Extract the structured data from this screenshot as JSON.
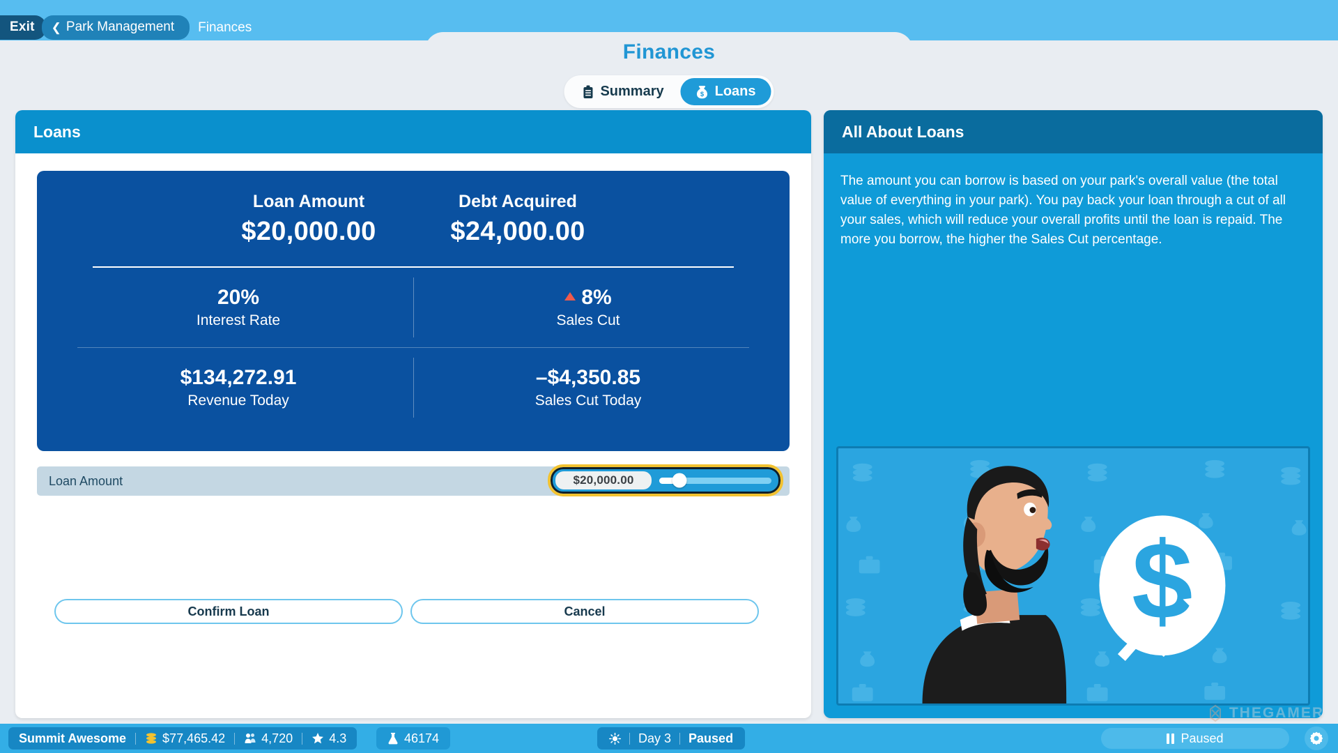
{
  "topbar": {
    "exit_label": "Exit",
    "back_chevron": "chevron-left-icon",
    "parent_label": "Park Management",
    "current_label": "Finances"
  },
  "header": {
    "title": "Finances"
  },
  "tabs": [
    {
      "label": "Summary",
      "icon": "clipboard-icon",
      "active": false
    },
    {
      "label": "Loans",
      "icon": "money-bag-icon",
      "active": true
    }
  ],
  "loans_panel": {
    "title": "Loans",
    "summary": {
      "loan_amount_label": "Loan Amount",
      "loan_amount_value": "$20,000.00",
      "debt_acquired_label": "Debt Acquired",
      "debt_acquired_value": "$24,000.00",
      "interest_rate_value": "20%",
      "interest_rate_label": "Interest Rate",
      "sales_cut_value": "8%",
      "sales_cut_label": "Sales Cut",
      "sales_cut_trend_icon": "triangle-up-icon",
      "sales_cut_trend_color": "#ef5a4c",
      "revenue_today_value": "$134,272.91",
      "revenue_today_label": "Revenue Today",
      "sales_cut_today_value": "–$4,350.85",
      "sales_cut_today_label": "Sales Cut Today"
    },
    "slider": {
      "label": "Loan Amount",
      "value": "$20,000.00",
      "percent": 18,
      "focus_ring_color": "#f2c230"
    },
    "buttons": {
      "confirm_label": "Confirm Loan",
      "cancel_label": "Cancel"
    }
  },
  "about_panel": {
    "title": "All About Loans",
    "body": "The amount you can borrow is based on your park's overall value (the total value of everything in your park). You pay back your loan through a cut of all your sales, which will reduce your overall profits until the loan is repaid. The more you borrow, the higher the Sales Cut percentage."
  },
  "statusbar": {
    "park_name": "Summit Awesome",
    "money_icon": "coins-icon",
    "money": "$77,465.42",
    "guests_icon": "guests-icon",
    "guests": "4,720",
    "rating_icon": "star-icon",
    "rating": "4.3",
    "research_icon": "flask-icon",
    "research": "46174",
    "weather_icon": "sun-icon",
    "day": "Day 3",
    "paused_label": "Paused",
    "pause_button_label": "Paused",
    "settings_icon": "gear-icon",
    "watermark": "THEGAMER"
  },
  "colors": {
    "sky": "#57bdf0",
    "panel_head": "#0a90cd",
    "panel_head_dark": "#0a6c9e",
    "loan_card": "#0a51a0",
    "accent": "#2196d4",
    "page_bg": "#e9edf2"
  }
}
